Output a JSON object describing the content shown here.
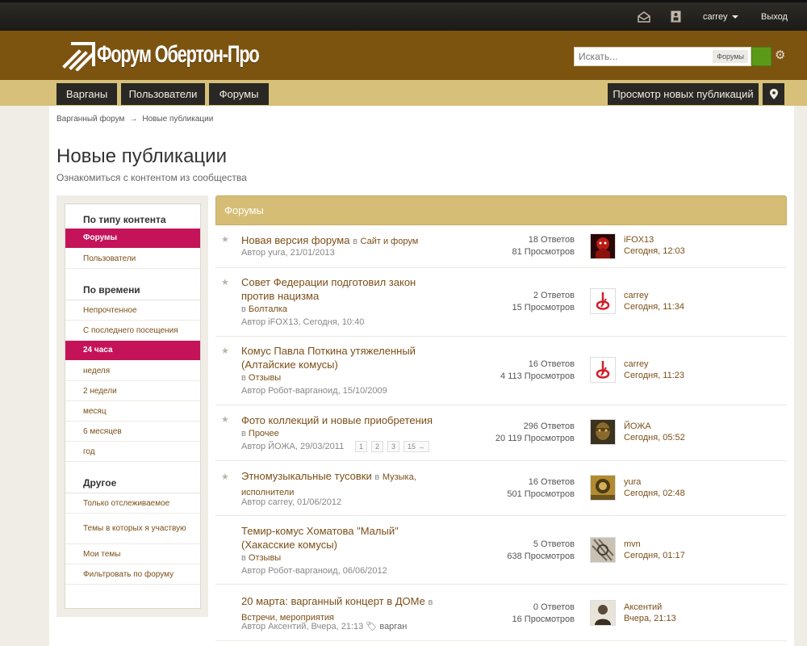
{
  "topbar": {
    "username": "carrey",
    "logout": "Выход"
  },
  "header": {
    "logo_text": "Форум Обертон-Про",
    "search_placeholder": "Искать...",
    "search_scope": "Форумы"
  },
  "nav": {
    "tabs": [
      "Варганы",
      "Пользователи",
      "Форумы"
    ],
    "new_posts": "Просмотр новых публикаций"
  },
  "breadcrumb": {
    "root": "Варганный форум",
    "arrow": "→",
    "current": "Новые публикации"
  },
  "page": {
    "title": "Новые публикации",
    "subtitle": "Ознакомиться с контентом из сообщества"
  },
  "sidebar": {
    "by_type": {
      "heading": "По типу контента",
      "items": [
        "Форумы",
        "Пользователи"
      ]
    },
    "by_time": {
      "heading": "По времени",
      "items": [
        "Непрочтенное",
        "С последнего посещения",
        "24 часа",
        "неделя",
        "2 недели",
        "месяц",
        "6 месяцев",
        "год"
      ]
    },
    "other": {
      "heading": "Другое",
      "items": [
        "Только отслеживаемое",
        "Темы в которых я участвую",
        "Мои темы",
        "Фильтровать по форуму"
      ]
    }
  },
  "content": {
    "heading": "Форумы",
    "threads": [
      {
        "title": "Новая версия форума",
        "forum_prefix": "в",
        "forum": "Сайт и форум",
        "meta": "Автор yura, 21/01/2013",
        "replies": "18 Ответов",
        "views": "81 Просмотров",
        "last_user": "iFOX13",
        "last_time": "Сегодня, 12:03",
        "starred": true
      },
      {
        "title": "Совет Федерации подготовил закон против нацизма",
        "forum_prefix": "в",
        "forum": "Болталка",
        "meta": "Автор iFOX13, Сегодня, 10:40",
        "replies": "2 Ответов",
        "views": "15 Просмотров",
        "last_user": "carrey",
        "last_time": "Сегодня, 11:34",
        "starred": true
      },
      {
        "title": "Комус Павла Поткина утяжеленный (Алтайские комусы)",
        "forum_prefix": "в",
        "forum": "Отзывы",
        "meta": "Автор Робот-варганоид, 15/10/2009",
        "replies": "16 Ответов",
        "views": "4 113 Просмотров",
        "last_user": "carrey",
        "last_time": "Сегодня, 11:23",
        "starred": true
      },
      {
        "title": "Фото коллекций и новые приобретения",
        "forum_prefix": "в",
        "forum": "Прочее",
        "meta": "Автор ЙОЖА, 29/03/2011",
        "pages": [
          "1",
          "2",
          "3",
          "15 →"
        ],
        "replies": "296 Ответов",
        "views": "20 119 Просмотров",
        "last_user": "ЙОЖА",
        "last_time": "Сегодня, 05:52",
        "starred": true
      },
      {
        "title": "Этномузыкальные тусовки",
        "forum_prefix": "в",
        "forum": "Музыка, исполнители",
        "meta": "Автор carrey, 01/06/2012",
        "replies": "16 Ответов",
        "views": "501 Просмотров",
        "last_user": "yura",
        "last_time": "Сегодня, 02:48",
        "starred": true
      },
      {
        "title": "Темир-комус Хоматова \"Малый\" (Хакасские комусы)",
        "forum_prefix": "в",
        "forum": "Отзывы",
        "meta": "Автор Робот-варганоид, 06/06/2012",
        "replies": "5 Ответов",
        "views": "638 Просмотров",
        "last_user": "mvn",
        "last_time": "Сегодня, 01:17",
        "starred": false
      },
      {
        "title": "20 марта: варганный концерт в ДОМе",
        "forum_prefix": "в",
        "forum": "Встречи, мероприятия",
        "meta": "Автор Аксентий, Вчера, 21:13",
        "tag": "варган",
        "replies": "0 Ответов",
        "views": "16 Просмотров",
        "last_user": "Аксентий",
        "last_time": "Вчера, 21:13",
        "starred": false
      }
    ]
  },
  "colors": {
    "header": "#7c5410",
    "nav": "#d7c079",
    "active": "#c5135a",
    "link": "#7b4f18"
  }
}
